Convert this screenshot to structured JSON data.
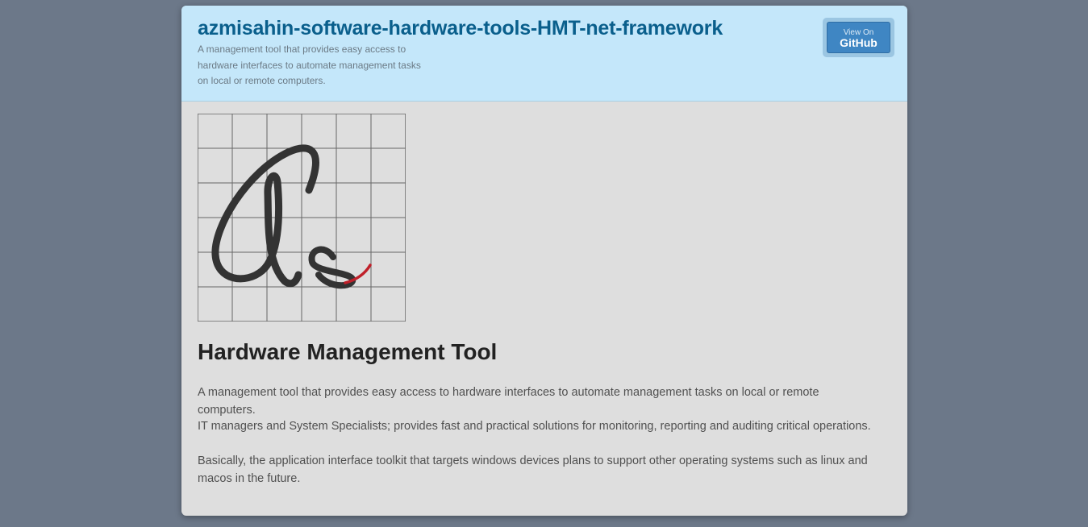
{
  "header": {
    "title": "azmisahin-software-hardware-tools-HMT-net-framework",
    "tagline_lines": [
      "A management tool that provides easy access to",
      "hardware interfaces to automate management tasks",
      "on local or remote computers."
    ],
    "github_button": {
      "small_label": "View On",
      "big_label": "GitHub"
    }
  },
  "logo": {
    "icon": "as-monogram-logo",
    "colors": {
      "grid": "#666666",
      "script": "#333333",
      "accent": "#c0202a"
    }
  },
  "main": {
    "heading": "Hardware Management Tool",
    "paragraphs": [
      "A management tool that provides easy access to hardware interfaces to automate management tasks on local or remote computers.",
      "IT managers and System Specialists; provides fast and practical solutions for monitoring, reporting and auditing critical operations.",
      "Basically, the application interface toolkit that targets windows devices plans to support other operating systems such as linux and macos in the future."
    ]
  },
  "colors": {
    "page_background": "#6c7889",
    "card_background": "#dedede",
    "header_background": "#c4e7fa",
    "title_color": "#0a5f8c",
    "button_color": "#3f86c3"
  }
}
